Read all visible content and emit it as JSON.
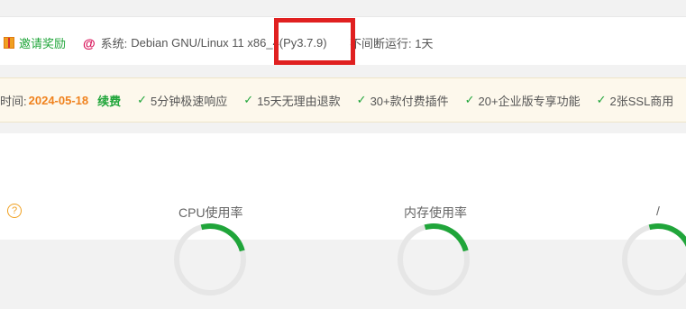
{
  "header": {
    "invite_label": "邀请奖励",
    "system_label": "系统:",
    "system_value": "Debian GNU/Linux 11 x86_",
    "system_py": "4(Py3.7.9)",
    "uptime_label": "不间断运行: 1天"
  },
  "promo": {
    "expire_label": "时间:",
    "expire_date": "2024-05-18",
    "renew_label": "续费",
    "features": [
      "5分钟极速响应",
      "15天无理由退款",
      "30+款付费插件",
      "20+企业版专享功能",
      "2张SSL商用"
    ]
  },
  "metrics": {
    "help_icon": "?",
    "cpu_label": "CPU使用率",
    "mem_label": "内存使用率",
    "disk_label": "/"
  },
  "colors": {
    "brand_green": "#20a53a",
    "date_orange": "#f0821e",
    "highlight_red": "#e02020"
  }
}
